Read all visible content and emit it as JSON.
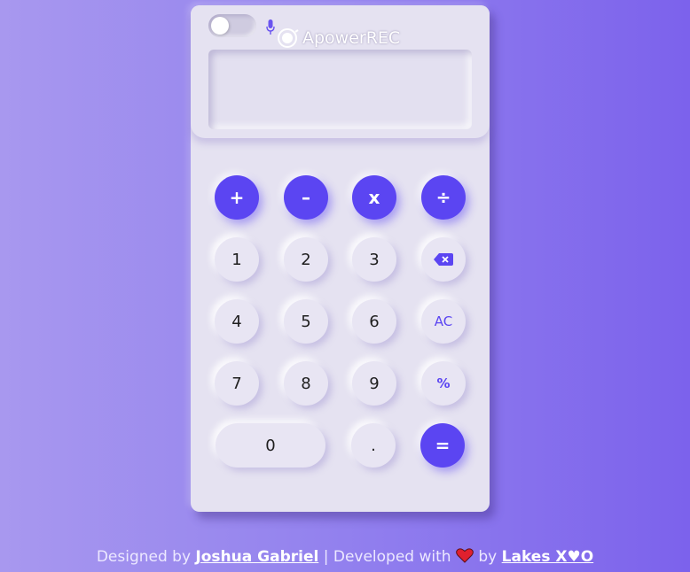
{
  "colors": {
    "accent": "#5b45f2",
    "calculator_surface": "#e5e2f1",
    "background_left": "#a898ef",
    "background_right": "#7c62ec",
    "heart": "#e0202e"
  },
  "header": {
    "toggle_state": "off",
    "mic_icon": "microphone-icon",
    "watermark_text": "ApowerREC"
  },
  "display": {
    "value": ""
  },
  "keys": {
    "add": "+",
    "subtract": "–",
    "multiply": "x",
    "divide": "÷",
    "one": "1",
    "two": "2",
    "three": "3",
    "backspace_icon": "backspace-icon",
    "four": "4",
    "five": "5",
    "six": "6",
    "clear": "AC",
    "seven": "7",
    "eight": "8",
    "nine": "9",
    "percent": "%",
    "zero": "0",
    "decimal": ".",
    "equals": "="
  },
  "footer": {
    "designed_by_prefix": "Designed by",
    "designer_name": "Joshua Gabriel",
    "separator": "|",
    "developed_with": "Developed with",
    "heart_icon": "heart-icon",
    "by": "by",
    "developer_name": "Lakes ꓫ♥O"
  }
}
